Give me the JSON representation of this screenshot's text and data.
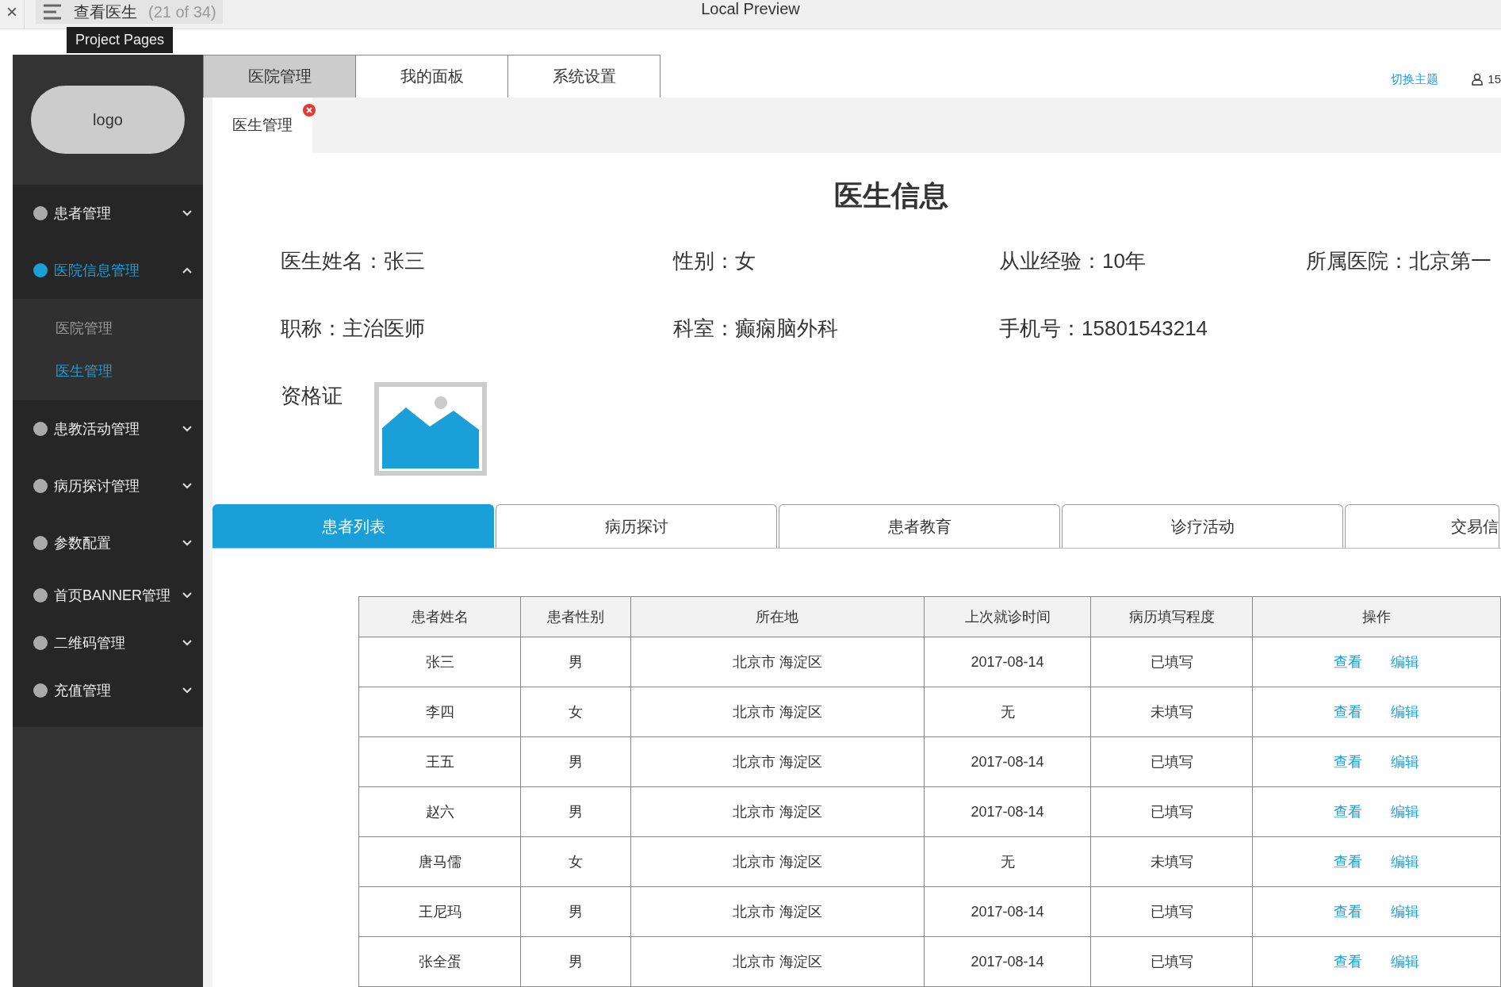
{
  "browser": {
    "close": "×",
    "title": "查看医生",
    "page_count": "(21 of 34)",
    "tooltip": "Project Pages",
    "preview_title": "Local Preview"
  },
  "sidebar": {
    "logo": "logo",
    "menu": [
      {
        "label": "患者管理",
        "selected": false,
        "expanded": false
      },
      {
        "label": "医院信息管理",
        "selected": true,
        "expanded": true,
        "children": [
          {
            "label": "医院管理",
            "selected": false
          },
          {
            "label": "医生管理",
            "selected": true
          }
        ]
      },
      {
        "label": "患教活动管理",
        "selected": false,
        "expanded": false
      },
      {
        "label": "病历探讨管理",
        "selected": false,
        "expanded": false
      },
      {
        "label": "参数配置",
        "selected": false,
        "expanded": false
      },
      {
        "label": "首页BANNER管理",
        "selected": false,
        "expanded": false
      },
      {
        "label": "二维码管理",
        "selected": false,
        "expanded": false
      },
      {
        "label": "充值管理",
        "selected": false,
        "expanded": false
      }
    ]
  },
  "top_nav": [
    {
      "label": "医院管理",
      "selected": true
    },
    {
      "label": "我的面板",
      "selected": false
    },
    {
      "label": "系统设置",
      "selected": false
    }
  ],
  "header": {
    "theme_link": "切换主题",
    "user": "15"
  },
  "page_tabs": [
    {
      "label": "医生管理",
      "closable": true
    }
  ],
  "doctor": {
    "title": "医生信息",
    "fields": [
      [
        "医生姓名：张三",
        "性别：女",
        "从业经验：10年",
        "所属医院：北京第一"
      ],
      [
        "职称：主治医师",
        "科室：癫痫脑外科",
        "手机号：15801543214"
      ]
    ],
    "certificate_label": "资格证"
  },
  "sub_tabs": [
    {
      "label": "患者列表",
      "selected": true
    },
    {
      "label": "病历探讨",
      "selected": false
    },
    {
      "label": "患者教育",
      "selected": false
    },
    {
      "label": "诊疗活动",
      "selected": false
    },
    {
      "label": "交易信",
      "selected": false
    }
  ],
  "table": {
    "columns": [
      "患者姓名",
      "患者性别",
      "所在地",
      "上次就诊时间",
      "病历填写程度",
      "操作"
    ],
    "rows": [
      {
        "cells": [
          "张三",
          "男",
          "北京市 海淀区",
          "2017-08-14",
          "已填写"
        ],
        "actions": [
          "查看",
          "编辑"
        ]
      },
      {
        "cells": [
          "李四",
          "女",
          "北京市 海淀区",
          "无",
          "未填写"
        ],
        "actions": [
          "查看",
          "编辑"
        ]
      },
      {
        "cells": [
          "王五",
          "男",
          "北京市 海淀区",
          "2017-08-14",
          "已填写"
        ],
        "actions": [
          "查看",
          "编辑"
        ]
      },
      {
        "cells": [
          "赵六",
          "男",
          "北京市 海淀区",
          "2017-08-14",
          "已填写"
        ],
        "actions": [
          "查看",
          "编辑"
        ]
      },
      {
        "cells": [
          "唐马儒",
          "女",
          "北京市 海淀区",
          "无",
          "未填写"
        ],
        "actions": [
          "查看",
          "编辑"
        ]
      },
      {
        "cells": [
          "王尼玛",
          "男",
          "北京市 海淀区",
          "2017-08-14",
          "已填写"
        ],
        "actions": [
          "查看",
          "编辑"
        ]
      },
      {
        "cells": [
          "张全蛋",
          "男",
          "北京市 海淀区",
          "2017-08-14",
          "已填写"
        ],
        "actions": [
          "查看",
          "编辑"
        ]
      }
    ]
  }
}
